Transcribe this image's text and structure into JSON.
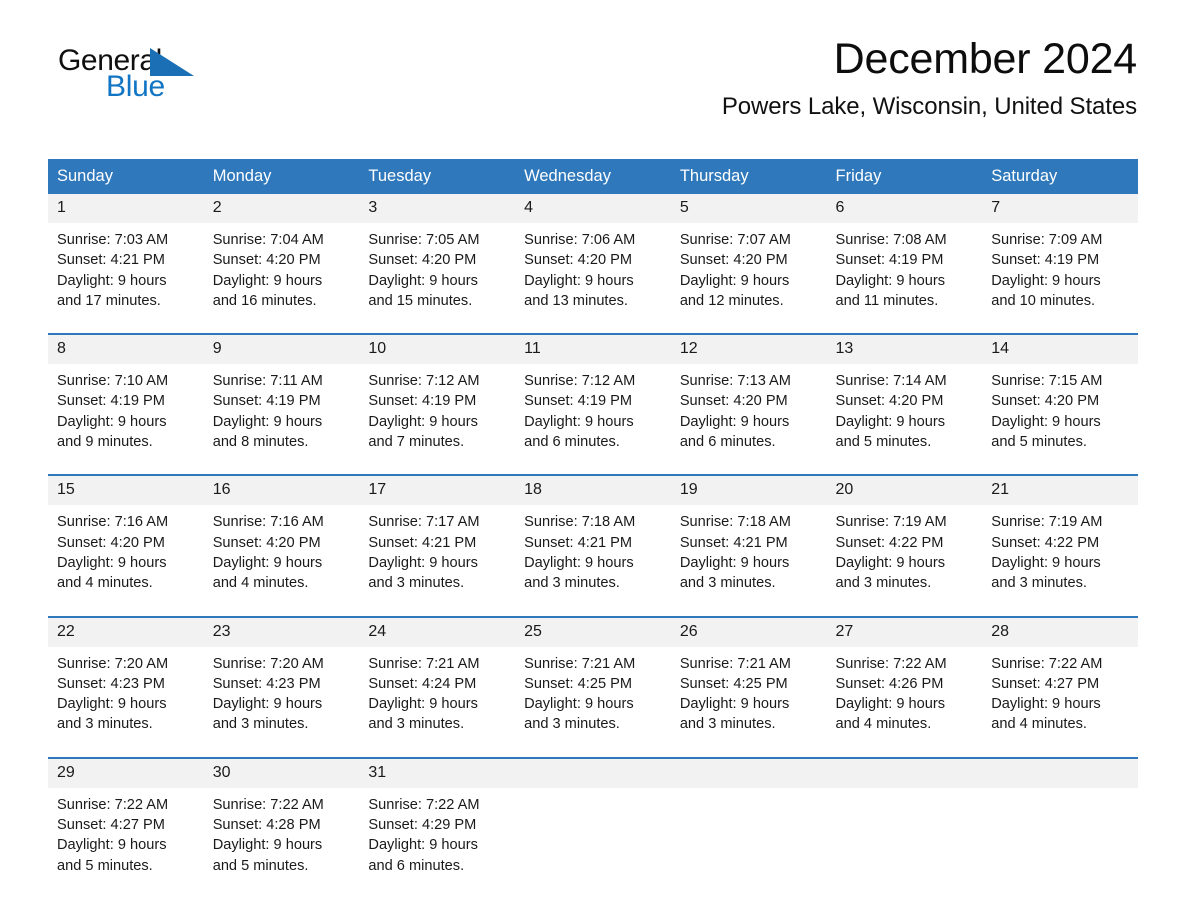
{
  "brand": {
    "name_part1": "General",
    "name_part2": "Blue",
    "logo_icon": "triangle-flag-icon",
    "accent_color": "#1a6fb5"
  },
  "header": {
    "month_title": "December 2024",
    "location": "Powers Lake, Wisconsin, United States"
  },
  "theme": {
    "header_blue": "#2e78bb",
    "daynum_band": "#f2f2f2",
    "text": "#1a1a1a"
  },
  "calendar": {
    "weekday_headers": [
      "Sunday",
      "Monday",
      "Tuesday",
      "Wednesday",
      "Thursday",
      "Friday",
      "Saturday"
    ],
    "weeks": [
      {
        "days": [
          {
            "date": "1",
            "sunrise": "Sunrise: 7:03 AM",
            "sunset": "Sunset: 4:21 PM",
            "daylight_line1": "Daylight: 9 hours",
            "daylight_line2": "and 17 minutes."
          },
          {
            "date": "2",
            "sunrise": "Sunrise: 7:04 AM",
            "sunset": "Sunset: 4:20 PM",
            "daylight_line1": "Daylight: 9 hours",
            "daylight_line2": "and 16 minutes."
          },
          {
            "date": "3",
            "sunrise": "Sunrise: 7:05 AM",
            "sunset": "Sunset: 4:20 PM",
            "daylight_line1": "Daylight: 9 hours",
            "daylight_line2": "and 15 minutes."
          },
          {
            "date": "4",
            "sunrise": "Sunrise: 7:06 AM",
            "sunset": "Sunset: 4:20 PM",
            "daylight_line1": "Daylight: 9 hours",
            "daylight_line2": "and 13 minutes."
          },
          {
            "date": "5",
            "sunrise": "Sunrise: 7:07 AM",
            "sunset": "Sunset: 4:20 PM",
            "daylight_line1": "Daylight: 9 hours",
            "daylight_line2": "and 12 minutes."
          },
          {
            "date": "6",
            "sunrise": "Sunrise: 7:08 AM",
            "sunset": "Sunset: 4:19 PM",
            "daylight_line1": "Daylight: 9 hours",
            "daylight_line2": "and 11 minutes."
          },
          {
            "date": "7",
            "sunrise": "Sunrise: 7:09 AM",
            "sunset": "Sunset: 4:19 PM",
            "daylight_line1": "Daylight: 9 hours",
            "daylight_line2": "and 10 minutes."
          }
        ]
      },
      {
        "days": [
          {
            "date": "8",
            "sunrise": "Sunrise: 7:10 AM",
            "sunset": "Sunset: 4:19 PM",
            "daylight_line1": "Daylight: 9 hours",
            "daylight_line2": "and 9 minutes."
          },
          {
            "date": "9",
            "sunrise": "Sunrise: 7:11 AM",
            "sunset": "Sunset: 4:19 PM",
            "daylight_line1": "Daylight: 9 hours",
            "daylight_line2": "and 8 minutes."
          },
          {
            "date": "10",
            "sunrise": "Sunrise: 7:12 AM",
            "sunset": "Sunset: 4:19 PM",
            "daylight_line1": "Daylight: 9 hours",
            "daylight_line2": "and 7 minutes."
          },
          {
            "date": "11",
            "sunrise": "Sunrise: 7:12 AM",
            "sunset": "Sunset: 4:19 PM",
            "daylight_line1": "Daylight: 9 hours",
            "daylight_line2": "and 6 minutes."
          },
          {
            "date": "12",
            "sunrise": "Sunrise: 7:13 AM",
            "sunset": "Sunset: 4:20 PM",
            "daylight_line1": "Daylight: 9 hours",
            "daylight_line2": "and 6 minutes."
          },
          {
            "date": "13",
            "sunrise": "Sunrise: 7:14 AM",
            "sunset": "Sunset: 4:20 PM",
            "daylight_line1": "Daylight: 9 hours",
            "daylight_line2": "and 5 minutes."
          },
          {
            "date": "14",
            "sunrise": "Sunrise: 7:15 AM",
            "sunset": "Sunset: 4:20 PM",
            "daylight_line1": "Daylight: 9 hours",
            "daylight_line2": "and 5 minutes."
          }
        ]
      },
      {
        "days": [
          {
            "date": "15",
            "sunrise": "Sunrise: 7:16 AM",
            "sunset": "Sunset: 4:20 PM",
            "daylight_line1": "Daylight: 9 hours",
            "daylight_line2": "and 4 minutes."
          },
          {
            "date": "16",
            "sunrise": "Sunrise: 7:16 AM",
            "sunset": "Sunset: 4:20 PM",
            "daylight_line1": "Daylight: 9 hours",
            "daylight_line2": "and 4 minutes."
          },
          {
            "date": "17",
            "sunrise": "Sunrise: 7:17 AM",
            "sunset": "Sunset: 4:21 PM",
            "daylight_line1": "Daylight: 9 hours",
            "daylight_line2": "and 3 minutes."
          },
          {
            "date": "18",
            "sunrise": "Sunrise: 7:18 AM",
            "sunset": "Sunset: 4:21 PM",
            "daylight_line1": "Daylight: 9 hours",
            "daylight_line2": "and 3 minutes."
          },
          {
            "date": "19",
            "sunrise": "Sunrise: 7:18 AM",
            "sunset": "Sunset: 4:21 PM",
            "daylight_line1": "Daylight: 9 hours",
            "daylight_line2": "and 3 minutes."
          },
          {
            "date": "20",
            "sunrise": "Sunrise: 7:19 AM",
            "sunset": "Sunset: 4:22 PM",
            "daylight_line1": "Daylight: 9 hours",
            "daylight_line2": "and 3 minutes."
          },
          {
            "date": "21",
            "sunrise": "Sunrise: 7:19 AM",
            "sunset": "Sunset: 4:22 PM",
            "daylight_line1": "Daylight: 9 hours",
            "daylight_line2": "and 3 minutes."
          }
        ]
      },
      {
        "days": [
          {
            "date": "22",
            "sunrise": "Sunrise: 7:20 AM",
            "sunset": "Sunset: 4:23 PM",
            "daylight_line1": "Daylight: 9 hours",
            "daylight_line2": "and 3 minutes."
          },
          {
            "date": "23",
            "sunrise": "Sunrise: 7:20 AM",
            "sunset": "Sunset: 4:23 PM",
            "daylight_line1": "Daylight: 9 hours",
            "daylight_line2": "and 3 minutes."
          },
          {
            "date": "24",
            "sunrise": "Sunrise: 7:21 AM",
            "sunset": "Sunset: 4:24 PM",
            "daylight_line1": "Daylight: 9 hours",
            "daylight_line2": "and 3 minutes."
          },
          {
            "date": "25",
            "sunrise": "Sunrise: 7:21 AM",
            "sunset": "Sunset: 4:25 PM",
            "daylight_line1": "Daylight: 9 hours",
            "daylight_line2": "and 3 minutes."
          },
          {
            "date": "26",
            "sunrise": "Sunrise: 7:21 AM",
            "sunset": "Sunset: 4:25 PM",
            "daylight_line1": "Daylight: 9 hours",
            "daylight_line2": "and 3 minutes."
          },
          {
            "date": "27",
            "sunrise": "Sunrise: 7:22 AM",
            "sunset": "Sunset: 4:26 PM",
            "daylight_line1": "Daylight: 9 hours",
            "daylight_line2": "and 4 minutes."
          },
          {
            "date": "28",
            "sunrise": "Sunrise: 7:22 AM",
            "sunset": "Sunset: 4:27 PM",
            "daylight_line1": "Daylight: 9 hours",
            "daylight_line2": "and 4 minutes."
          }
        ]
      },
      {
        "days": [
          {
            "date": "29",
            "sunrise": "Sunrise: 7:22 AM",
            "sunset": "Sunset: 4:27 PM",
            "daylight_line1": "Daylight: 9 hours",
            "daylight_line2": "and 5 minutes."
          },
          {
            "date": "30",
            "sunrise": "Sunrise: 7:22 AM",
            "sunset": "Sunset: 4:28 PM",
            "daylight_line1": "Daylight: 9 hours",
            "daylight_line2": "and 5 minutes."
          },
          {
            "date": "31",
            "sunrise": "Sunrise: 7:22 AM",
            "sunset": "Sunset: 4:29 PM",
            "daylight_line1": "Daylight: 9 hours",
            "daylight_line2": "and 6 minutes."
          },
          {
            "date": "",
            "sunrise": "",
            "sunset": "",
            "daylight_line1": "",
            "daylight_line2": ""
          },
          {
            "date": "",
            "sunrise": "",
            "sunset": "",
            "daylight_line1": "",
            "daylight_line2": ""
          },
          {
            "date": "",
            "sunrise": "",
            "sunset": "",
            "daylight_line1": "",
            "daylight_line2": ""
          },
          {
            "date": "",
            "sunrise": "",
            "sunset": "",
            "daylight_line1": "",
            "daylight_line2": ""
          }
        ]
      }
    ]
  }
}
